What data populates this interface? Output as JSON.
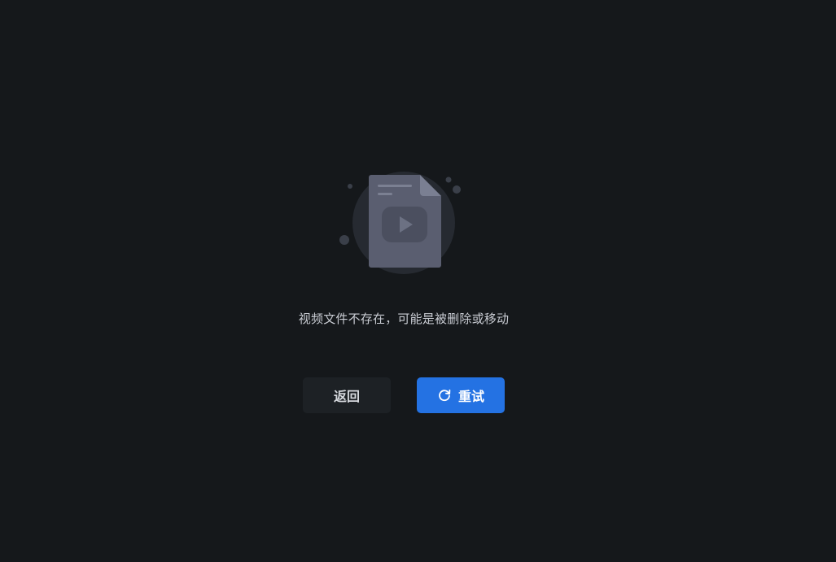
{
  "empty_state": {
    "icon": "missing-video-file-icon",
    "message": "视频文件不存在，可能是被删除或移动"
  },
  "actions": {
    "back_label": "返回",
    "retry_label": "重试",
    "retry_icon": "refresh-icon"
  },
  "colors": {
    "background": "#15181b",
    "primary": "#2472e3",
    "secondary_button": "#1d2125",
    "text": "#c9ccd3"
  }
}
